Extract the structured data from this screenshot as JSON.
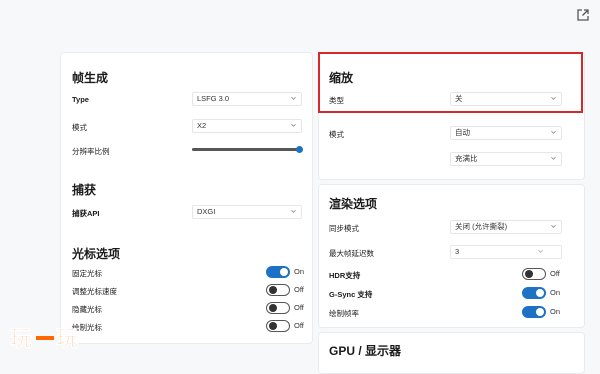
{
  "header": {
    "external_icon": "open-external-icon"
  },
  "frame_gen": {
    "title": "帧生成",
    "type_label": "Type",
    "type_value": "LSFG 3.0",
    "mode_label": "模式",
    "mode_value": "X2",
    "resolution_label": "分辨率比例",
    "resolution_level": 1.0
  },
  "capture": {
    "title": "捕获",
    "api_label": "捕获API",
    "api_value": "DXGI"
  },
  "cursor": {
    "title": "光标选项",
    "items": [
      {
        "label": "固定光标",
        "state": "On",
        "on": true
      },
      {
        "label": "调整光标速度",
        "state": "Off",
        "on": false
      },
      {
        "label": "隐藏光标",
        "state": "Off",
        "on": false
      },
      {
        "label": "绘制光标",
        "state": "Off",
        "on": false
      }
    ]
  },
  "scaling": {
    "title": "缩放",
    "type_label": "类型",
    "type_value": "关",
    "mode_label": "模式",
    "mode_value": "自动",
    "mode2_value": "充满比"
  },
  "render": {
    "title": "渲染选项",
    "sync_label": "同步模式",
    "sync_value": "关闭 (允许撕裂)",
    "max_frames_label": "最大帧延迟数",
    "max_frames_value": "3",
    "hdr_label": "HDR支持",
    "hdr_state": "Off",
    "gsync_label": "G-Sync 支持",
    "gsync_state": "On",
    "draw_fps_label": "绘制帧率",
    "draw_fps_state": "On"
  },
  "gpu": {
    "title": "GPU / 显示器"
  },
  "watermark": {
    "text": "玩一玩"
  },
  "colors": {
    "accent": "#1d72c4",
    "highlight": "#d62828",
    "watermark": "#ff6a00"
  }
}
